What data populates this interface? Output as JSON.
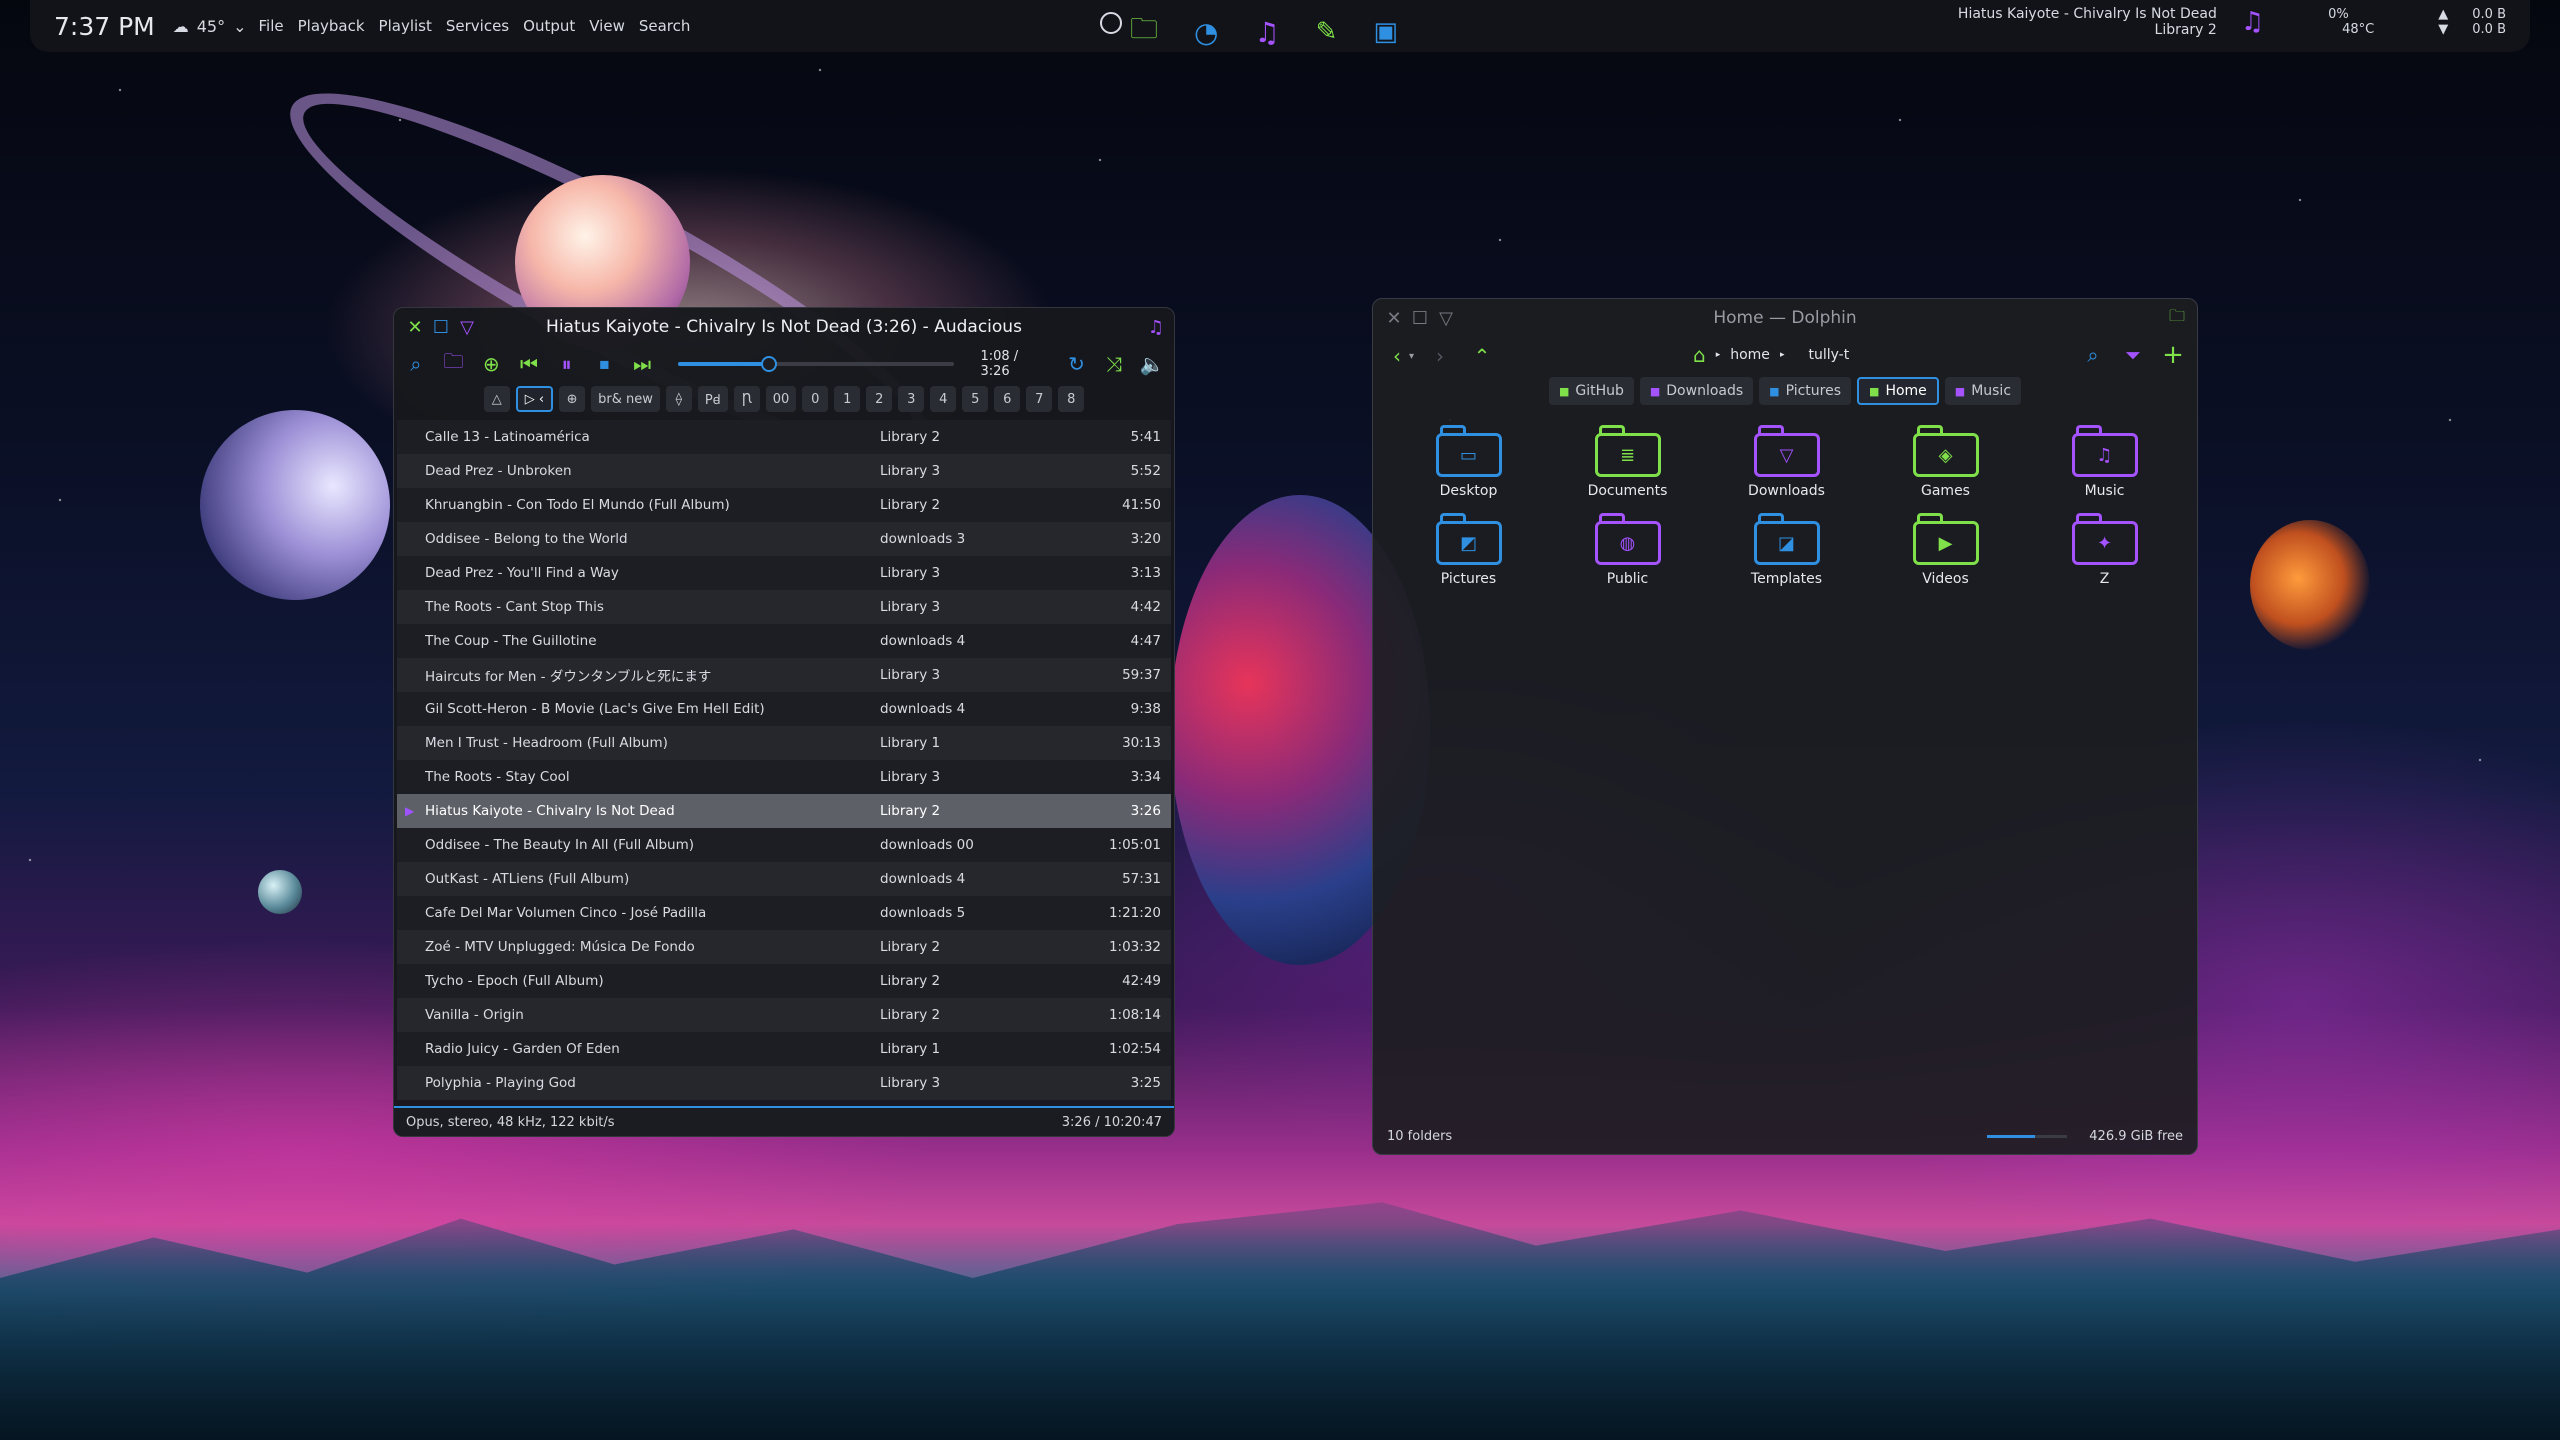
{
  "panel": {
    "clock": "7:37 PM",
    "weather": "45°",
    "menus": [
      "File",
      "Playback",
      "Playlist",
      "Services",
      "Output",
      "View",
      "Search"
    ],
    "now_playing_title": "Hiatus Kaiyote - Chivalry Is Not Dead",
    "now_playing_album": "Library 2",
    "cpu": "0%",
    "temp": "48°C",
    "net_up": "0.0 B",
    "net_down": "0.0 B"
  },
  "audacious": {
    "title": "Hiatus Kaiyote - Chivalry Is Not Dead (3:26) - Audacious",
    "time": "1:08 / 3:26",
    "progress": 0.33,
    "tabs": [
      "△",
      "▷ ‹",
      "⊕",
      "br& new",
      "⟠",
      "Pꟈ",
      "Ꞃ",
      "00",
      "0",
      "1",
      "2",
      "3",
      "4",
      "5",
      "6",
      "7",
      "8"
    ],
    "active_tab": 1,
    "tracks": [
      {
        "title": "Calle 13 - Latinoamérica",
        "album": "Library 2",
        "length": "5:41"
      },
      {
        "title": "Dead Prez - Unbroken",
        "album": "Library 3",
        "length": "5:52"
      },
      {
        "title": "Khruangbin - Con Todo El Mundo (Full Album)",
        "album": "Library 2",
        "length": "41:50"
      },
      {
        "title": "Oddisee - Belong to the World",
        "album": "downloads 3",
        "length": "3:20"
      },
      {
        "title": "Dead Prez - You'll Find a Way",
        "album": "Library 3",
        "length": "3:13"
      },
      {
        "title": "The Roots - Cant Stop This",
        "album": "Library 3",
        "length": "4:42"
      },
      {
        "title": "The Coup - The Guillotine",
        "album": "downloads 4",
        "length": "4:47"
      },
      {
        "title": "Haircuts for Men - ダウンタンブルと死にます",
        "album": "Library 3",
        "length": "59:37"
      },
      {
        "title": "Gil Scott-Heron - B Movie (Lac's Give Em Hell Edit)",
        "album": "downloads 4",
        "length": "9:38"
      },
      {
        "title": "Men I Trust - Headroom (Full Album)",
        "album": "Library 1",
        "length": "30:13"
      },
      {
        "title": "The Roots - Stay Cool",
        "album": "Library 3",
        "length": "3:34"
      },
      {
        "title": "Hiatus Kaiyote - Chivalry Is Not Dead",
        "album": "Library 2",
        "length": "3:26",
        "current": true
      },
      {
        "title": "Oddisee - The Beauty In All (Full Album)",
        "album": "downloads 00",
        "length": "1:05:01"
      },
      {
        "title": "OutKast - ATLiens (Full Album)",
        "album": "downloads 4",
        "length": "57:31"
      },
      {
        "title": "Cafe Del Mar Volumen Cinco - José Padilla",
        "album": "downloads 5",
        "length": "1:21:20"
      },
      {
        "title": "Zoé - MTV Unplugged: Música De Fondo",
        "album": "Library 2",
        "length": "1:03:32"
      },
      {
        "title": "Tycho - Epoch (Full Album)",
        "album": "Library 2",
        "length": "42:49"
      },
      {
        "title": "Vanilla - Origin",
        "album": "Library 2",
        "length": "1:08:14"
      },
      {
        "title": "Radio Juicy - Garden Of Eden",
        "album": "Library 1",
        "length": "1:02:54"
      },
      {
        "title": "Polyphia - Playing God",
        "album": "Library 3",
        "length": "3:25"
      }
    ],
    "status_left": "Opus, stereo, 48 kHz, 122 kbit/s",
    "status_right": "3:26 / 10:20:47"
  },
  "dolphin": {
    "title": "Home — Dolphin",
    "crumbs": [
      "home",
      "tully-t"
    ],
    "places": [
      {
        "label": "GitHub",
        "color": "#7fe04a"
      },
      {
        "label": "Downloads",
        "color": "#a552ff"
      },
      {
        "label": "Pictures",
        "color": "#2f8fe0"
      },
      {
        "label": "Home",
        "color": "#7fe04a"
      },
      {
        "label": "Music",
        "color": "#a552ff"
      }
    ],
    "active_place": 3,
    "folders": [
      {
        "name": "Desktop",
        "color": "#2f8fe0",
        "glyph": "▭"
      },
      {
        "name": "Documents",
        "color": "#7fe04a",
        "glyph": "≣"
      },
      {
        "name": "Downloads",
        "color": "#a552ff",
        "glyph": "▽"
      },
      {
        "name": "Games",
        "color": "#7fe04a",
        "glyph": "◈"
      },
      {
        "name": "Music",
        "color": "#a552ff",
        "glyph": "♫"
      },
      {
        "name": "Pictures",
        "color": "#2f8fe0",
        "glyph": "◩"
      },
      {
        "name": "Public",
        "color": "#a552ff",
        "glyph": "◍"
      },
      {
        "name": "Templates",
        "color": "#2f8fe0",
        "glyph": "◪"
      },
      {
        "name": "Videos",
        "color": "#7fe04a",
        "glyph": "▶"
      },
      {
        "name": "Z",
        "color": "#a552ff",
        "glyph": "✦"
      }
    ],
    "status_left": "10 folders",
    "status_right": "426.9 GiB free",
    "free_fraction": 0.6
  },
  "colors": {
    "accent_blue": "#2f8fe0",
    "accent_green": "#7fe04a",
    "accent_purple": "#a552ff"
  }
}
